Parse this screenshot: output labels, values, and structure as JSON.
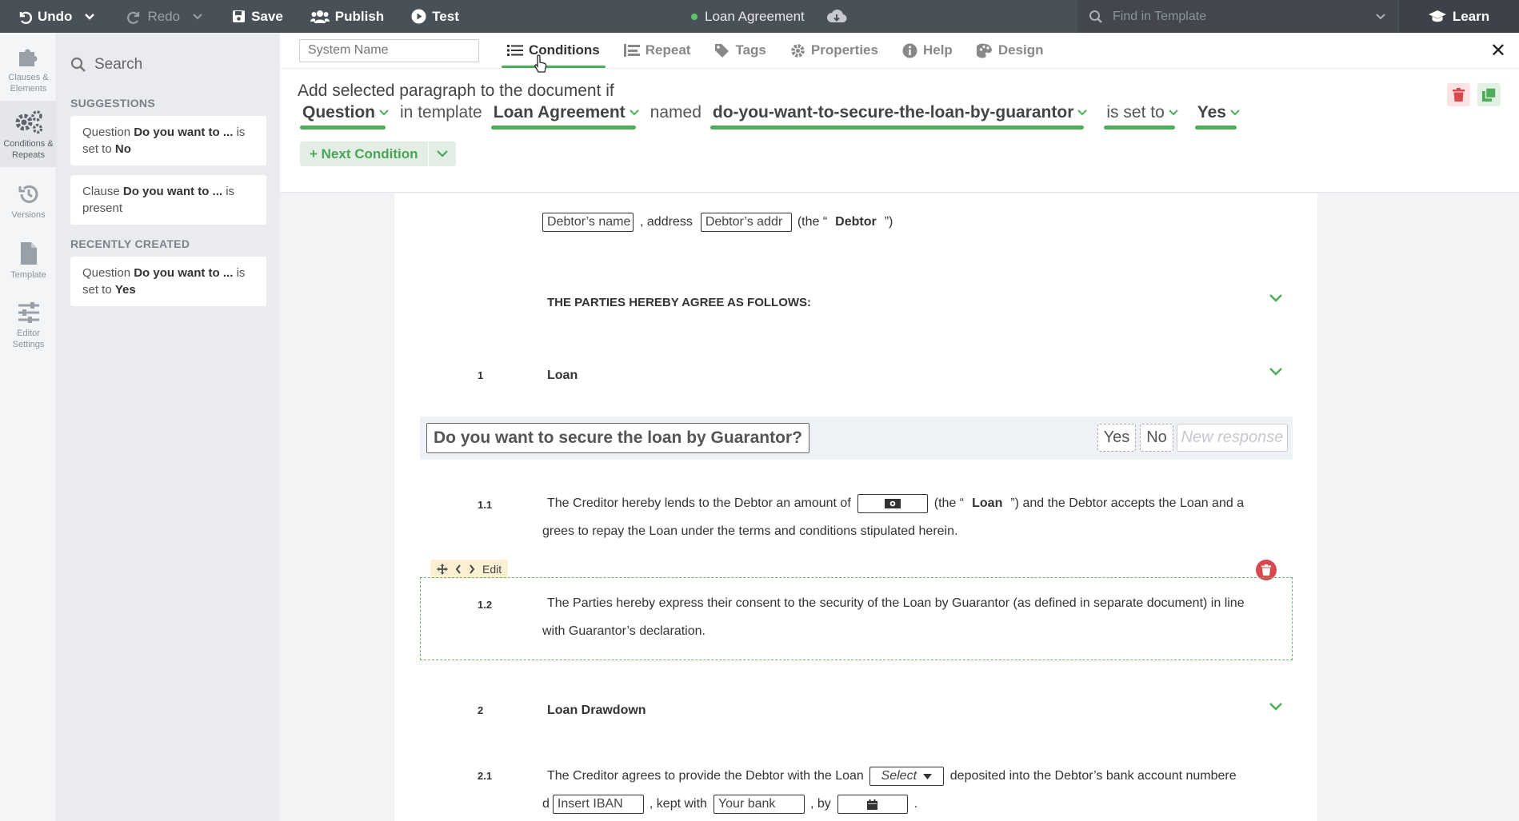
{
  "topbar": {
    "undo": "Undo",
    "redo": "Redo",
    "save": "Save",
    "publish": "Publish",
    "test": "Test",
    "doc_title": "Loan Agreement",
    "find_placeholder": "Find in Template",
    "learn": "Learn"
  },
  "rail": {
    "items": [
      {
        "label": "Clauses & Elements",
        "icon": "puzzle-icon"
      },
      {
        "label": "Conditions & Repeats",
        "icon": "gears-icon"
      },
      {
        "label": "Versions",
        "icon": "history-icon"
      },
      {
        "label": "Template",
        "icon": "file-icon"
      },
      {
        "label": "Editor Settings",
        "icon": "sliders-icon"
      }
    ]
  },
  "panel": {
    "search_label": "Search",
    "suggestions_heading": "SUGGESTIONS",
    "recent_heading": "RECENTLY CREATED",
    "suggestions": [
      {
        "kind": "Question",
        "name": "Do you want to ...",
        "mid": "is set to",
        "value": "No"
      },
      {
        "kind": "Clause",
        "name": "Do you want to ...",
        "mid": "is present",
        "value": ""
      }
    ],
    "recent": [
      {
        "kind": "Question",
        "name": "Do you want to ...",
        "mid": "is set to",
        "value": "Yes"
      }
    ]
  },
  "tabs": {
    "system_name_placeholder": "System Name",
    "items": [
      "Conditions",
      "Repeat",
      "Tags",
      "Properties",
      "Help",
      "Design"
    ],
    "close": "✕"
  },
  "condition": {
    "intro": "Add selected paragraph to the document if",
    "kind": "Question",
    "in_template": "in template",
    "template": "Loan Agreement",
    "named": "named",
    "question_name": "do-you-want-to-secure-the-loan-by-guarantor",
    "operator": "is set to",
    "value": "Yes",
    "next_condition": "+ Next Condition"
  },
  "document": {
    "debtor_name_field": "Debtor’s name",
    "address_text": ", address",
    "debtor_addr_field": "Debtor’s addr",
    "the_open": "(the “",
    "debtor_def": "Debtor",
    "the_close": "”)",
    "agree_heading": "THE PARTIES HEREBY AGREE AS FOLLOWS:",
    "section1_num": "1",
    "section1_title": "Loan",
    "question": {
      "label": "Do you want to secure the loan by Guarantor?",
      "responses": [
        "Yes",
        "No"
      ],
      "new_response_placeholder": "New response"
    },
    "p11_num": "1.1",
    "p11_a": "The Creditor hereby lends to the Debtor an amount of",
    "p11_the_open": "(the “",
    "p11_loan_def": "Loan",
    "p11_b": "”) and the Debtor accepts the Loan and a",
    "p11_c": "grees to repay the Loan under the terms and conditions stipulated herein.",
    "edit_label": "Edit",
    "p12_num": "1.2",
    "p12_a": "The Parties hereby express their consent to the security of the Loan by Guarantor (as defined in separate document) in line",
    "p12_b": "with Guarantor’s declaration.",
    "section2_num": "2",
    "section2_title": "Loan Drawdown",
    "p21_num": "2.1",
    "p21_a": "The Creditor agrees to provide the Debtor with the Loan",
    "p21_select": "Select",
    "p21_b": "deposited into the Debtor’s bank account numbere",
    "p21_c": "d",
    "p21_iban": "Insert IBAN",
    "p21_kept": ", kept with",
    "p21_bank": "Your bank",
    "p21_by": ", by",
    "p21_end": "."
  },
  "colors": {
    "accent_green": "#4cae5a",
    "topbar_bg": "#4a5058",
    "delete_red": "#d9484f"
  }
}
